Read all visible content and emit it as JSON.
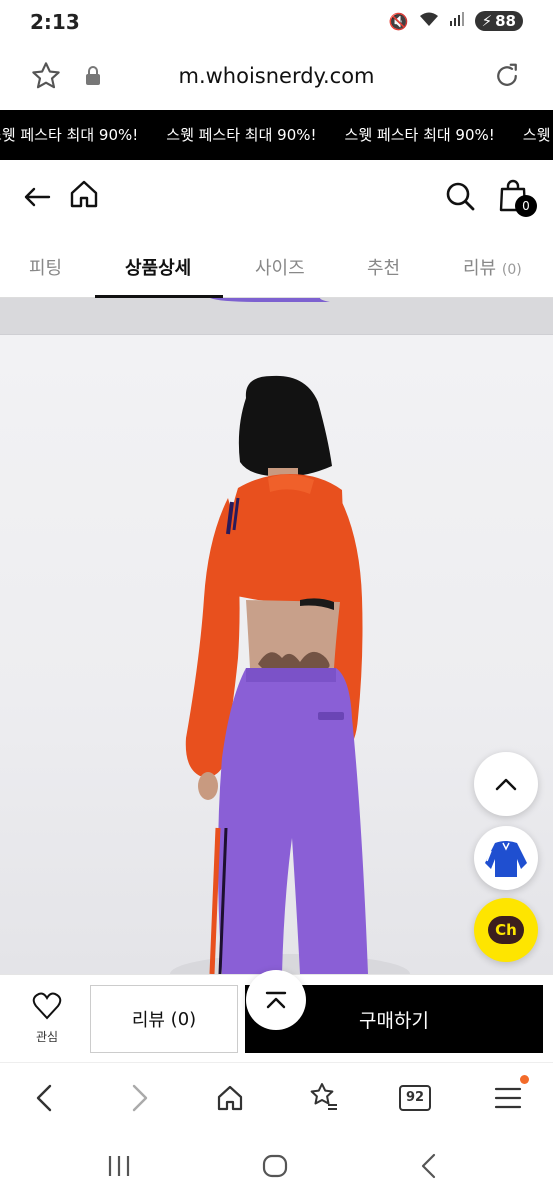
{
  "status_bar": {
    "time": "2:13",
    "battery": "88"
  },
  "browser": {
    "url": "m.whoisnerdy.com",
    "tab_count": "92"
  },
  "promo": {
    "text": "스웻 페스타 최대 90%!"
  },
  "header": {
    "cart_count": "0"
  },
  "tabs": [
    {
      "label": "피팅"
    },
    {
      "label": "상품상세"
    },
    {
      "label": "사이즈"
    },
    {
      "label": "추천"
    },
    {
      "label": "리뷰",
      "count": "(0)"
    }
  ],
  "floating": {
    "chat_label": "Ch"
  },
  "buy_bar": {
    "wish_label": "관심",
    "review_label": "리뷰",
    "review_count": "(0)",
    "buy_label": "구매하기"
  },
  "colors": {
    "jacket": "#e8501e",
    "pants": "#8a5fd6",
    "chat": "#fee500",
    "accent": "#000000"
  }
}
